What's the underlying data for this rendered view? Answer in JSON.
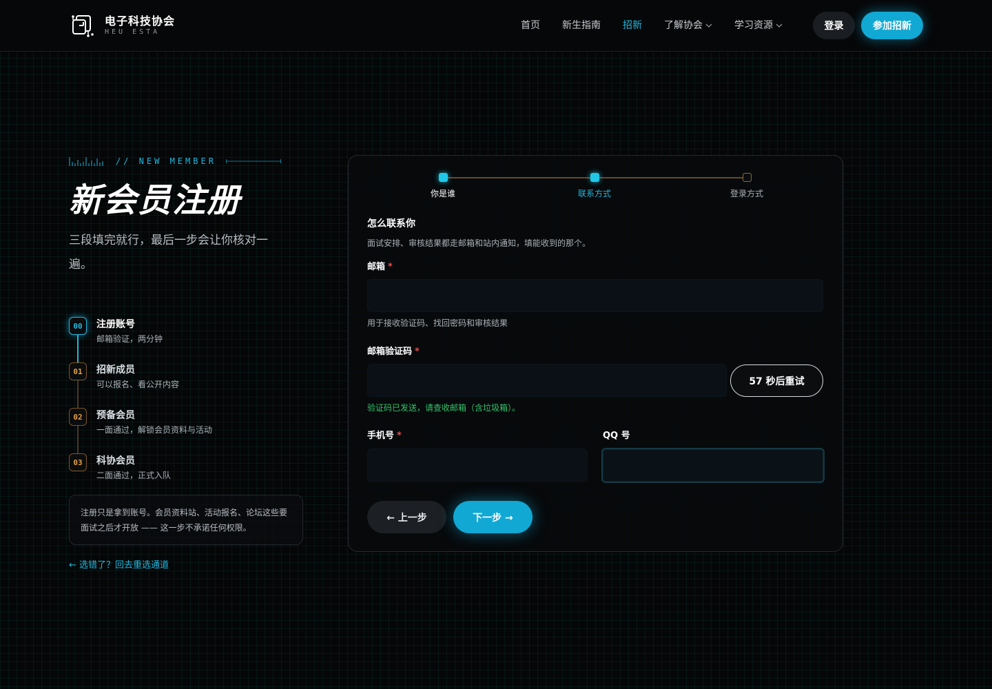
{
  "header": {
    "logo_title": "电子科技协会",
    "logo_sub": "HEU ESTA",
    "nav": [
      {
        "label": "首页",
        "active": false,
        "dropdown": false
      },
      {
        "label": "新生指南",
        "active": false,
        "dropdown": false
      },
      {
        "label": "招新",
        "active": true,
        "dropdown": false
      },
      {
        "label": "了解协会",
        "active": false,
        "dropdown": true
      },
      {
        "label": "学习资源",
        "active": false,
        "dropdown": true
      }
    ],
    "login_label": "登录",
    "join_label": "参加招新"
  },
  "intro": {
    "kicker": "// NEW MEMBER",
    "title": "新会员注册",
    "description": "三段填完就行，最后一步会让你核对一遍。"
  },
  "steps": [
    {
      "badge": "00",
      "title": "注册账号",
      "desc": "邮箱验证，两分钟",
      "active": true
    },
    {
      "badge": "01",
      "title": "招新成员",
      "desc": "可以报名、看公开内容",
      "active": false
    },
    {
      "badge": "02",
      "title": "预备会员",
      "desc": "一面通过，解锁会员资料与活动",
      "active": false
    },
    {
      "badge": "03",
      "title": "科协会员",
      "desc": "二面通过，正式入队",
      "active": false
    }
  ],
  "note": "注册只是拿到账号。会员资料站、活动报名、论坛这些要面试之后才开放 —— 这一步不承诺任何权限。",
  "back_link": "← 选错了？回去重选通道",
  "progress": {
    "current_step": 2,
    "total_steps": 3,
    "labels": [
      "你是谁",
      "联系方式",
      "登录方式"
    ]
  },
  "form": {
    "section_title": "怎么联系你",
    "section_desc": "面试安排、审核结果都走邮箱和站内通知，填能收到的那个。",
    "email": {
      "label": "邮箱",
      "required_mark": "*",
      "value": "",
      "hint": "用于接收验证码、找回密码和审核结果"
    },
    "code": {
      "label": "邮箱验证码",
      "required_mark": "*",
      "value": "",
      "retry_label": "57 秒后重试",
      "hint": "验证码已发送，请查收邮箱（含垃圾箱）。"
    },
    "phone": {
      "label": "手机号",
      "required_mark": "*",
      "value": ""
    },
    "qq": {
      "label": "QQ 号",
      "value": ""
    },
    "prev_label": "← 上一步",
    "next_label": "下一步 →"
  },
  "colors": {
    "accent": "#11a8d4",
    "accent_bright": "#22c8e8",
    "step_pending": "#e2a04a",
    "success": "#35c46a",
    "required": "#e84a4a",
    "background": "#050607"
  }
}
